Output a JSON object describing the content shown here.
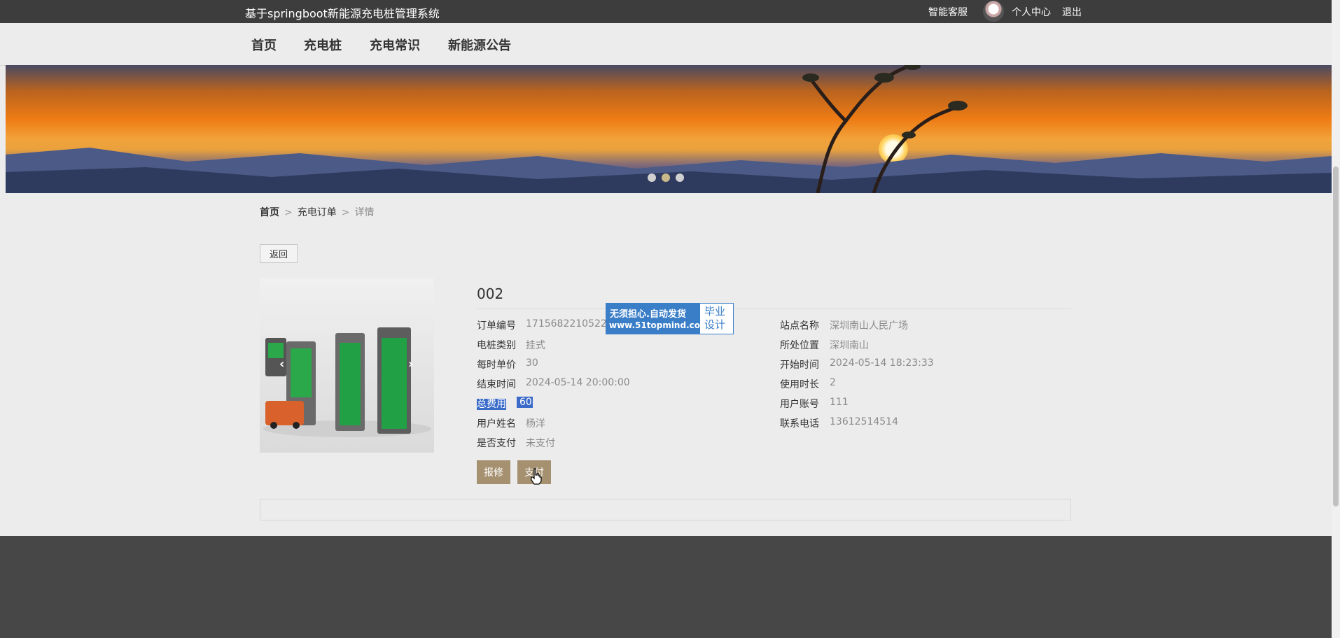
{
  "topbar": {
    "title": "基于springboot新能源充电桩管理系统",
    "service": "智能客服",
    "center": "个人中心",
    "logout": "退出"
  },
  "nav": [
    "首页",
    "充电桩",
    "充电常识",
    "新能源公告"
  ],
  "breadcrumb": [
    "首页",
    "充电订单",
    "详情"
  ],
  "back_label": "返回",
  "detail": {
    "title": "002",
    "left": [
      {
        "label": "订单编号",
        "value": "1715682210522"
      },
      {
        "label": "电桩类别",
        "value": "挂式"
      },
      {
        "label": "每时单价",
        "value": "30"
      },
      {
        "label": "结束时间",
        "value": "2024-05-14 20:00:00"
      },
      {
        "label": "总费用",
        "value": "60"
      },
      {
        "label": "用户姓名",
        "value": "杨洋"
      },
      {
        "label": "是否支付",
        "value": "未支付"
      }
    ],
    "right": [
      {
        "label": "站点名称",
        "value": "深圳南山人民广场"
      },
      {
        "label": "所处位置",
        "value": "深圳南山"
      },
      {
        "label": "开始时间",
        "value": "2024-05-14 18:23:33"
      },
      {
        "label": "使用时长",
        "value": "2"
      },
      {
        "label": "用户账号",
        "value": "111"
      },
      {
        "label": "联系电话",
        "value": "13612514514"
      }
    ]
  },
  "buttons": {
    "repair": "报修",
    "pay": "支付"
  },
  "watermark": {
    "line1": "无须担心.自动发货",
    "line2": "www.51topmind.com",
    "right1": "毕业",
    "right2": "设计"
  },
  "colors": {
    "topbar": "#3d3d3d",
    "button": "#a5906f",
    "footer": "#474747",
    "highlight": "#3a6bc9"
  }
}
